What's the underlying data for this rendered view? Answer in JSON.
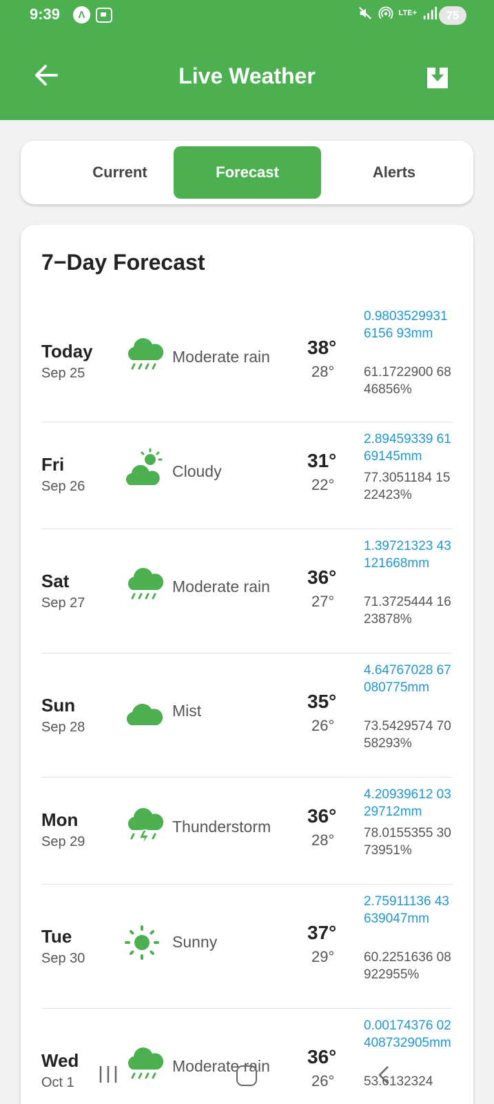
{
  "status_bar": {
    "time": "9:39",
    "lte_label": "LTE+",
    "battery": "75",
    "icons": [
      "navigation-icon",
      "screenshot-icon",
      "mute-icon",
      "hotspot-icon",
      "signal-icon",
      "signal-icon",
      "battery-icon"
    ]
  },
  "app_bar": {
    "title": "Live Weather",
    "back_icon": "arrow-left-icon",
    "download_icon": "download-icon",
    "color": "#4caf50"
  },
  "tabs": [
    {
      "label": "Current",
      "active": false
    },
    {
      "label": "Forecast",
      "active": true
    },
    {
      "label": "Alerts",
      "active": false
    }
  ],
  "forecast": {
    "title": "7−Day Forecast",
    "days": [
      {
        "day": "Today",
        "date": "Sep 25",
        "icon": "rain-cloud-icon",
        "condition": "Moderate rain",
        "high": "38°",
        "low": "28°",
        "precip": "0.98035299316156 93mm",
        "humidity": "61.1722900 6846856%"
      },
      {
        "day": "Fri",
        "date": "Sep 26",
        "icon": "partly-cloudy-icon",
        "condition": "Cloudy",
        "high": "31°",
        "low": "22°",
        "precip": "2.89459339 6169145mm",
        "humidity": "77.3051184 1522423%"
      },
      {
        "day": "Sat",
        "date": "Sep 27",
        "icon": "rain-cloud-icon",
        "condition": "Moderate rain",
        "high": "36°",
        "low": "27°",
        "precip": "1.39721323 43121668mm",
        "humidity": "71.3725444 1623878%"
      },
      {
        "day": "Sun",
        "date": "Sep 28",
        "icon": "cloud-icon",
        "condition": "Mist",
        "high": "35°",
        "low": "26°",
        "precip": "4.64767028 67080775mm",
        "humidity": "73.5429574 7058293%"
      },
      {
        "day": "Mon",
        "date": "Sep 29",
        "icon": "thunderstorm-icon",
        "condition": "Thunderstorm",
        "high": "36°",
        "low": "28°",
        "precip": "4.20939612 0329712mm",
        "humidity": "78.0155355 3073951%"
      },
      {
        "day": "Tue",
        "date": "Sep 30",
        "icon": "sun-icon",
        "condition": "Sunny",
        "high": "37°",
        "low": "29°",
        "precip": "2.75911136 43639047mm",
        "humidity": "60.2251636 08922955%"
      },
      {
        "day": "Wed",
        "date": "Oct 1",
        "icon": "rain-cloud-icon",
        "condition": "Moderate rain",
        "high": "36°",
        "low": "26°",
        "precip": "0.00174376 02408732905mm",
        "humidity": "53.6132324"
      }
    ]
  },
  "nav_bar": {
    "icons": [
      "recent-apps-icon",
      "home-icon",
      "back-icon"
    ]
  }
}
